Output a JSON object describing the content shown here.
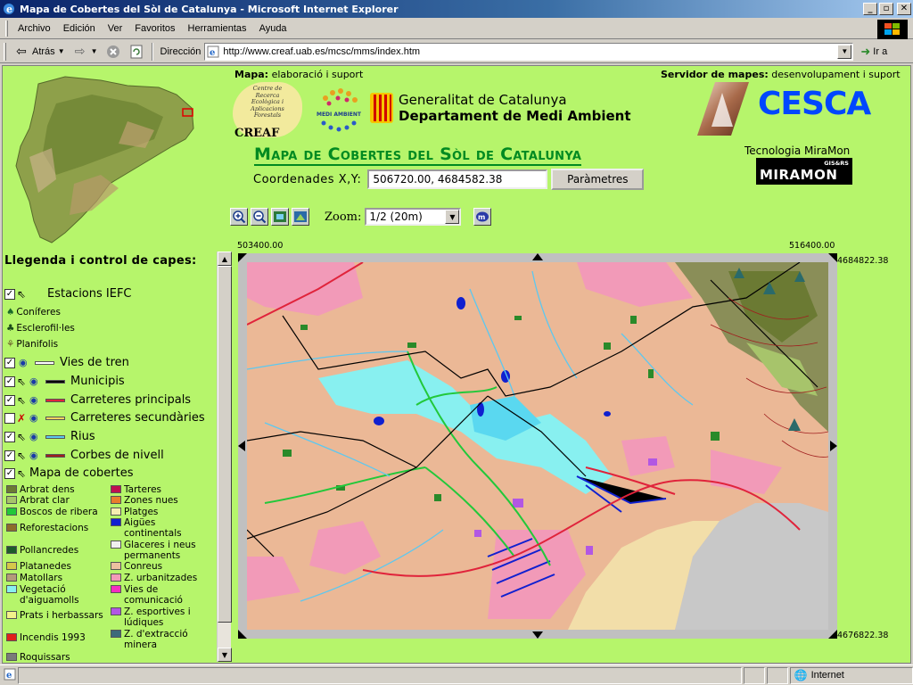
{
  "window": {
    "title": "Mapa de Cobertes del Sòl de Catalunya - Microsoft Internet Explorer",
    "min": "_",
    "max": "▫",
    "close": "✕"
  },
  "menu": [
    "Archivo",
    "Edición",
    "Ver",
    "Favoritos",
    "Herramientas",
    "Ayuda"
  ],
  "toolbar": {
    "back_label": "Atrás",
    "address_label": "Dirección",
    "url": "http://www.creaf.uab.es/mcsc/mms/index.htm",
    "go_label": "Ir a"
  },
  "header": {
    "left_key": "Mapa:",
    "left_value": "elaboració i suport",
    "right_key": "Servidor de mapes:",
    "right_value": "desenvolupament i suport"
  },
  "creaf": {
    "subtitle_lines": [
      "Centre de",
      "Recerca",
      "Ecològica i",
      "Aplicacions",
      "Forestals"
    ],
    "name": "CREAF"
  },
  "medi_ambient_label": "MEDI AMBIENT",
  "gencat": {
    "line1": "Generalitat de Catalunya",
    "line2": "Departament de Medi Ambient"
  },
  "cesca_label": "CESCA",
  "tecnologia": "Tecnologia MiraMon",
  "miramon": {
    "name": "MIRAMON",
    "gis": "GIS&RS"
  },
  "map_title": "Mapa de Cobertes del Sòl de Catalunya",
  "coords": {
    "label": "Coordenades X,Y:",
    "value": "506720.00, 4684582.38",
    "button": "Paràmetres"
  },
  "zoom": {
    "label": "Zoom:",
    "value": "1/2 (20m)"
  },
  "legend": {
    "title": "Llegenda i control de capes:",
    "layers": [
      {
        "name": "Estacions IEFC",
        "checked": true
      },
      {
        "name": "Vies de tren",
        "checked": true,
        "color": "#ffffff"
      },
      {
        "name": "Municipis",
        "checked": true,
        "color": "#000000"
      },
      {
        "name": "Carreteres principals",
        "checked": true,
        "color": "#e0233b"
      },
      {
        "name": "Carreteres secundàries",
        "checked": false,
        "color": "#f2d35e"
      },
      {
        "name": "Rius",
        "checked": true,
        "color": "#5cc8f0"
      },
      {
        "name": "Corbes de nivell",
        "checked": true,
        "color": "#a01e1e"
      },
      {
        "name": "Mapa de cobertes",
        "checked": true
      }
    ],
    "sublabels": [
      "Coníferes",
      "Esclerofil·les",
      "Planifolis"
    ],
    "covers_left": [
      {
        "name": "Arbrat dens",
        "color": "#6b7a33"
      },
      {
        "name": "Arbrat clar",
        "color": "#a7c46b"
      },
      {
        "name": "Boscos de ribera",
        "color": "#22c83a"
      },
      {
        "name": "Reforestacions",
        "color": "#8d6d2a"
      },
      {
        "name": "Pollancredes",
        "color": "#1d5c2a"
      },
      {
        "name": "Platanedes",
        "color": "#d5c84a"
      },
      {
        "name": "Matollars",
        "color": "#b39a7a"
      },
      {
        "name": "Vegetació d'aiguamolls",
        "color": "#88f0f0"
      },
      {
        "name": "Prats i herbassars",
        "color": "#f2f28a"
      },
      {
        "name": "Incendis 1993",
        "color": "#e0201b"
      },
      {
        "name": "Roquissars",
        "color": "#7a7a7a"
      }
    ],
    "covers_right": [
      {
        "name": "Tarteres",
        "color": "#c01050"
      },
      {
        "name": "Zones nues",
        "color": "#e87d2c"
      },
      {
        "name": "Platges",
        "color": "#f5eeb0"
      },
      {
        "name": "Aigües continentals",
        "color": "#1020d0"
      },
      {
        "name": "Glaceres i neus permanents",
        "color": "#f0f0f0"
      },
      {
        "name": "Conreus",
        "color": "#ecc0a0"
      },
      {
        "name": "Z. urbanitzades",
        "color": "#f29ab8"
      },
      {
        "name": "Vies de comunicació",
        "color": "#f52dbf"
      },
      {
        "name": "Z. esportives i lúdiques",
        "color": "#b257e3"
      },
      {
        "name": "Z. d'extracció minera",
        "color": "#3d6a7a"
      }
    ]
  },
  "map_coords": {
    "x_min": "503400.00",
    "x_max": "516400.00",
    "y_max": "4684822.38",
    "y_min": "4676822.38"
  },
  "status": {
    "zone": "Internet"
  }
}
